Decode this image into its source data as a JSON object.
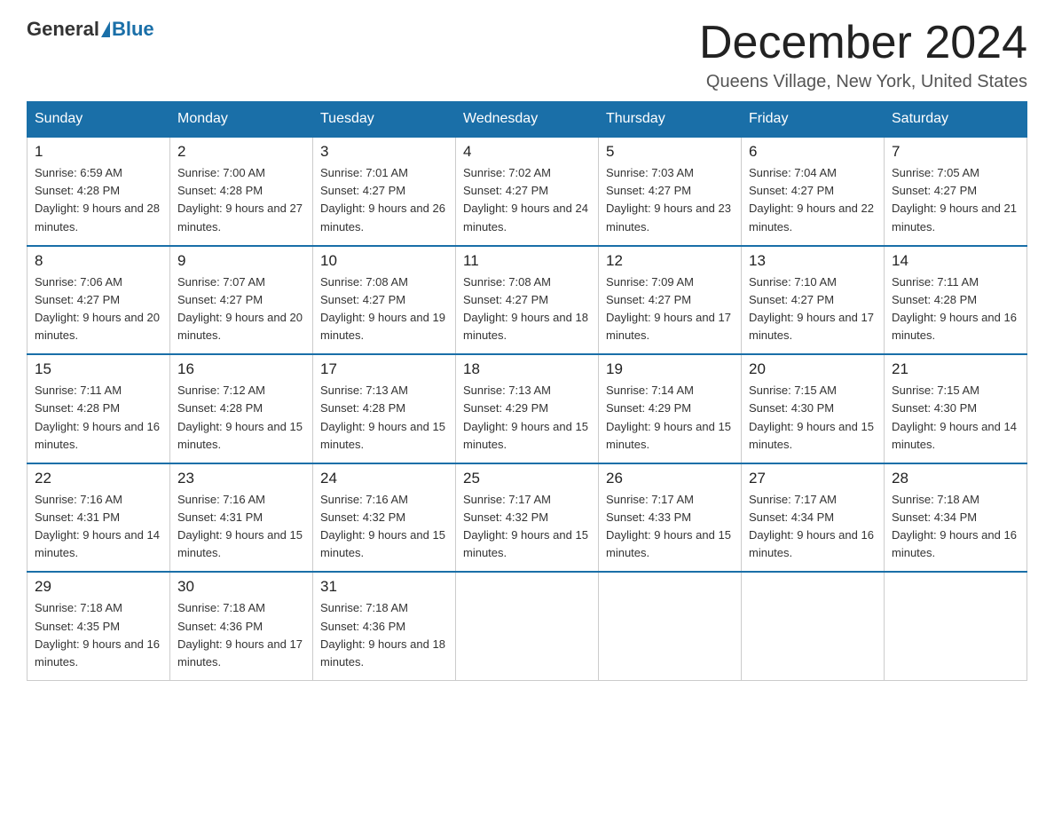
{
  "header": {
    "logo_general": "General",
    "logo_blue": "Blue",
    "month_title": "December 2024",
    "location": "Queens Village, New York, United States"
  },
  "days_of_week": [
    "Sunday",
    "Monday",
    "Tuesday",
    "Wednesday",
    "Thursday",
    "Friday",
    "Saturday"
  ],
  "weeks": [
    [
      {
        "num": "1",
        "sunrise": "6:59 AM",
        "sunset": "4:28 PM",
        "daylight": "9 hours and 28 minutes."
      },
      {
        "num": "2",
        "sunrise": "7:00 AM",
        "sunset": "4:28 PM",
        "daylight": "9 hours and 27 minutes."
      },
      {
        "num": "3",
        "sunrise": "7:01 AM",
        "sunset": "4:27 PM",
        "daylight": "9 hours and 26 minutes."
      },
      {
        "num": "4",
        "sunrise": "7:02 AM",
        "sunset": "4:27 PM",
        "daylight": "9 hours and 24 minutes."
      },
      {
        "num": "5",
        "sunrise": "7:03 AM",
        "sunset": "4:27 PM",
        "daylight": "9 hours and 23 minutes."
      },
      {
        "num": "6",
        "sunrise": "7:04 AM",
        "sunset": "4:27 PM",
        "daylight": "9 hours and 22 minutes."
      },
      {
        "num": "7",
        "sunrise": "7:05 AM",
        "sunset": "4:27 PM",
        "daylight": "9 hours and 21 minutes."
      }
    ],
    [
      {
        "num": "8",
        "sunrise": "7:06 AM",
        "sunset": "4:27 PM",
        "daylight": "9 hours and 20 minutes."
      },
      {
        "num": "9",
        "sunrise": "7:07 AM",
        "sunset": "4:27 PM",
        "daylight": "9 hours and 20 minutes."
      },
      {
        "num": "10",
        "sunrise": "7:08 AM",
        "sunset": "4:27 PM",
        "daylight": "9 hours and 19 minutes."
      },
      {
        "num": "11",
        "sunrise": "7:08 AM",
        "sunset": "4:27 PM",
        "daylight": "9 hours and 18 minutes."
      },
      {
        "num": "12",
        "sunrise": "7:09 AM",
        "sunset": "4:27 PM",
        "daylight": "9 hours and 17 minutes."
      },
      {
        "num": "13",
        "sunrise": "7:10 AM",
        "sunset": "4:27 PM",
        "daylight": "9 hours and 17 minutes."
      },
      {
        "num": "14",
        "sunrise": "7:11 AM",
        "sunset": "4:28 PM",
        "daylight": "9 hours and 16 minutes."
      }
    ],
    [
      {
        "num": "15",
        "sunrise": "7:11 AM",
        "sunset": "4:28 PM",
        "daylight": "9 hours and 16 minutes."
      },
      {
        "num": "16",
        "sunrise": "7:12 AM",
        "sunset": "4:28 PM",
        "daylight": "9 hours and 15 minutes."
      },
      {
        "num": "17",
        "sunrise": "7:13 AM",
        "sunset": "4:28 PM",
        "daylight": "9 hours and 15 minutes."
      },
      {
        "num": "18",
        "sunrise": "7:13 AM",
        "sunset": "4:29 PM",
        "daylight": "9 hours and 15 minutes."
      },
      {
        "num": "19",
        "sunrise": "7:14 AM",
        "sunset": "4:29 PM",
        "daylight": "9 hours and 15 minutes."
      },
      {
        "num": "20",
        "sunrise": "7:15 AM",
        "sunset": "4:30 PM",
        "daylight": "9 hours and 15 minutes."
      },
      {
        "num": "21",
        "sunrise": "7:15 AM",
        "sunset": "4:30 PM",
        "daylight": "9 hours and 14 minutes."
      }
    ],
    [
      {
        "num": "22",
        "sunrise": "7:16 AM",
        "sunset": "4:31 PM",
        "daylight": "9 hours and 14 minutes."
      },
      {
        "num": "23",
        "sunrise": "7:16 AM",
        "sunset": "4:31 PM",
        "daylight": "9 hours and 15 minutes."
      },
      {
        "num": "24",
        "sunrise": "7:16 AM",
        "sunset": "4:32 PM",
        "daylight": "9 hours and 15 minutes."
      },
      {
        "num": "25",
        "sunrise": "7:17 AM",
        "sunset": "4:32 PM",
        "daylight": "9 hours and 15 minutes."
      },
      {
        "num": "26",
        "sunrise": "7:17 AM",
        "sunset": "4:33 PM",
        "daylight": "9 hours and 15 minutes."
      },
      {
        "num": "27",
        "sunrise": "7:17 AM",
        "sunset": "4:34 PM",
        "daylight": "9 hours and 16 minutes."
      },
      {
        "num": "28",
        "sunrise": "7:18 AM",
        "sunset": "4:34 PM",
        "daylight": "9 hours and 16 minutes."
      }
    ],
    [
      {
        "num": "29",
        "sunrise": "7:18 AM",
        "sunset": "4:35 PM",
        "daylight": "9 hours and 16 minutes."
      },
      {
        "num": "30",
        "sunrise": "7:18 AM",
        "sunset": "4:36 PM",
        "daylight": "9 hours and 17 minutes."
      },
      {
        "num": "31",
        "sunrise": "7:18 AM",
        "sunset": "4:36 PM",
        "daylight": "9 hours and 18 minutes."
      },
      null,
      null,
      null,
      null
    ]
  ]
}
